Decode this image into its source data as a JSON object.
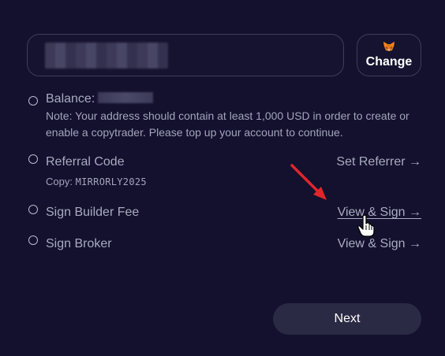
{
  "wallet": {
    "address_placeholder": "",
    "change_label": "Change",
    "icon": "metamask-fox-icon"
  },
  "steps": [
    {
      "label": "Balance:",
      "note": "Note: Your address should contain at least 1,000 USD in order to create or enable a copytrader. Please top up your account to continue."
    },
    {
      "label": "Referral Code",
      "copy_prefix": "Copy:",
      "copy_code": "MIRRORLY2025",
      "action": "Set Referrer →"
    },
    {
      "label": "Sign Builder Fee",
      "action": "View & Sign →"
    },
    {
      "label": "Sign Broker",
      "action": "View & Sign →"
    }
  ],
  "next_label": "Next",
  "colors": {
    "background": "#13112e",
    "annotation_arrow": "#e0262a"
  }
}
